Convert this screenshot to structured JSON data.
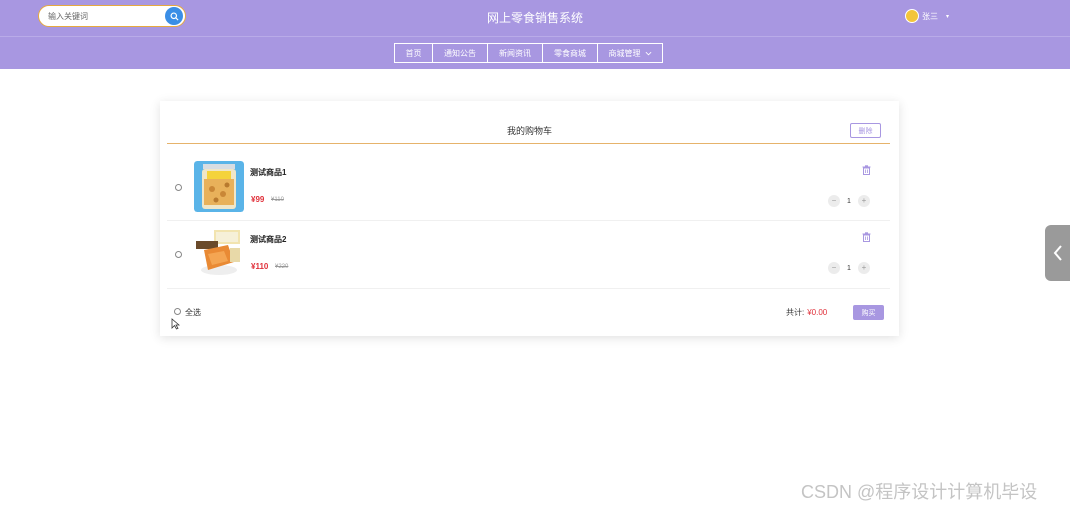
{
  "header": {
    "search_placeholder": "输入关键词",
    "site_title": "网上零食销售系统",
    "username": "张三"
  },
  "nav": {
    "items": [
      {
        "label": "首页"
      },
      {
        "label": "通知公告"
      },
      {
        "label": "新闻资讯"
      },
      {
        "label": "零食商城"
      },
      {
        "label": "商城管理"
      }
    ]
  },
  "cart": {
    "title": "我的购物车",
    "delete_label": "删除",
    "items": [
      {
        "name": "测试商品1",
        "price": "¥99",
        "original_price": "¥110",
        "quantity": "1"
      },
      {
        "name": "测试商品2",
        "price": "¥110",
        "original_price": "¥220",
        "quantity": "1"
      }
    ],
    "select_all_label": "全选",
    "total_label": "共计:",
    "total_value": "¥0.00",
    "buy_label": "购买"
  },
  "colors": {
    "header_bg": "#a897e1",
    "price": "#e0303a",
    "search_button": "#3a8ee6"
  },
  "watermark": "CSDN @程序设计计算机毕设"
}
